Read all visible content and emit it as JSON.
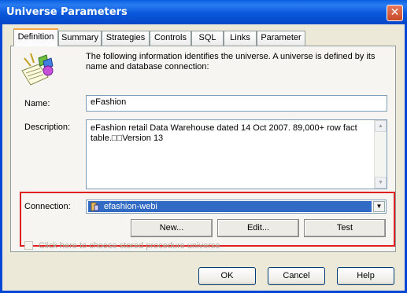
{
  "window": {
    "title": "Universe Parameters",
    "close_glyph": "✕"
  },
  "tabs": [
    {
      "label": "Definition"
    },
    {
      "label": "Summary"
    },
    {
      "label": "Strategies"
    },
    {
      "label": "Controls"
    },
    {
      "label": "SQL"
    },
    {
      "label": "Links"
    },
    {
      "label": "Parameter"
    }
  ],
  "definition": {
    "intro": "The following information identifies the universe. A universe is defined by its name and database connection:",
    "name_label": "Name:",
    "name_value": "eFashion",
    "description_label": "Description:",
    "description_value": "eFashion retail Data Warehouse dated 14 Oct 2007. 89,000+ row fact table.□□Version 13",
    "connection_label": "Connection:",
    "connection_value": "efashion-webi",
    "buttons": {
      "new": "New...",
      "edit": "Edit...",
      "test": "Test"
    },
    "stored_procedure_label": "Click here to choose stored procedure universe"
  },
  "footer": {
    "ok": "OK",
    "cancel": "Cancel",
    "help": "Help"
  },
  "icons": {
    "universe": "universe-icon",
    "database": "database-icon",
    "dropdown": "chevron-down-icon"
  },
  "colors": {
    "accent": "#e02020",
    "title_bar": "#0a58dc",
    "selection": "#316ac5"
  }
}
